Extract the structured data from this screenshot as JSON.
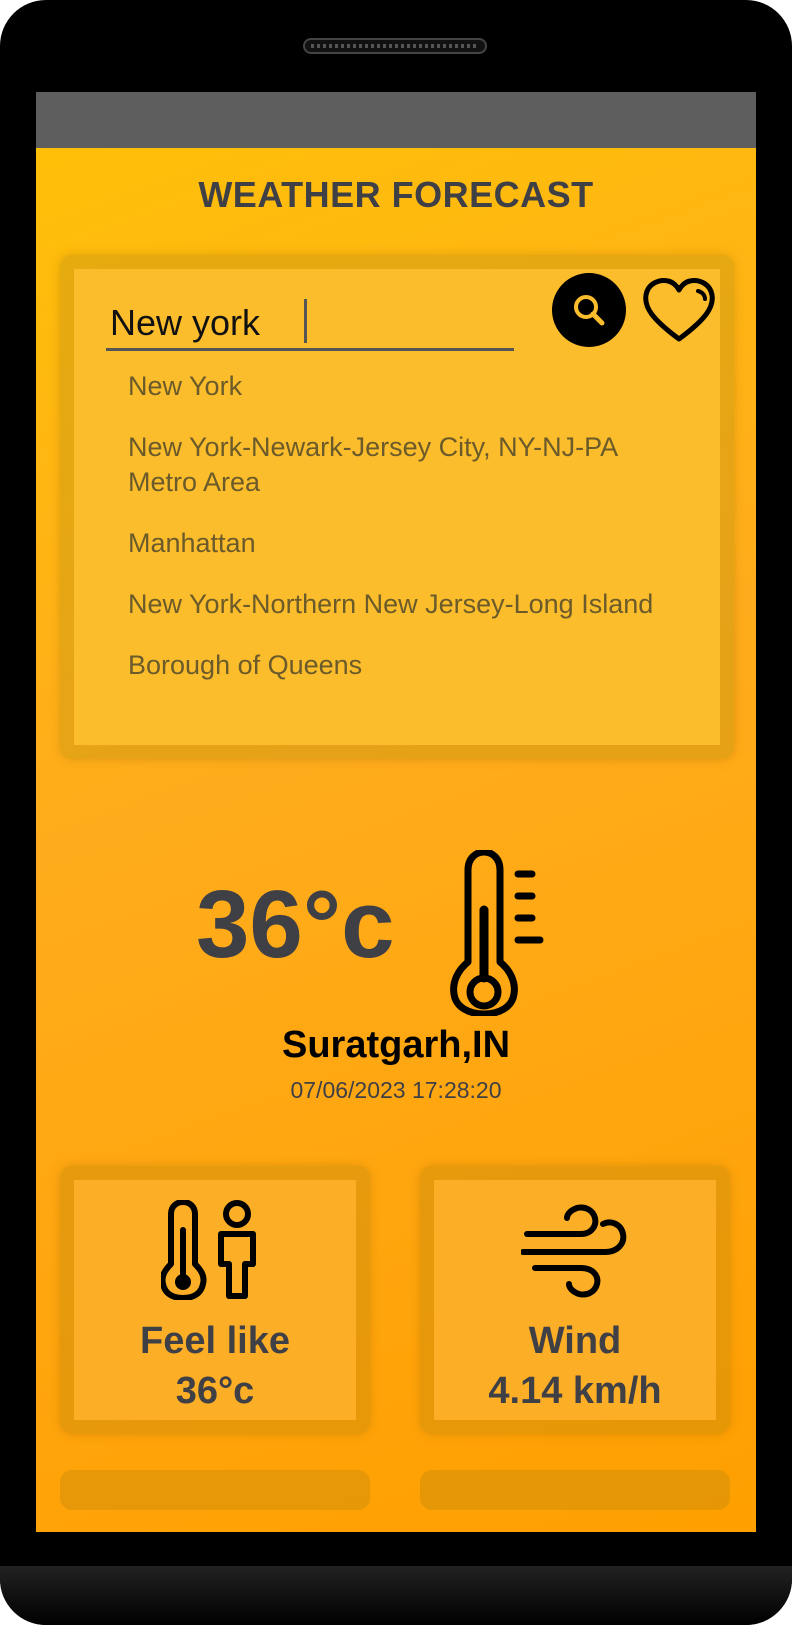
{
  "app": {
    "title": "WEATHER FORECAST"
  },
  "search": {
    "value": "New york",
    "suggestions": [
      "New York",
      "New York-Newark-Jersey City, NY-NJ-PA Metro Area",
      "Manhattan",
      "New York-Northern New Jersey-Long Island",
      "Borough of Queens"
    ]
  },
  "current": {
    "temperature": "36°c",
    "city": "Suratgarh,IN",
    "datetime": "07/06/2023 17:28:20"
  },
  "stats": {
    "feel": {
      "label": "Feel like",
      "value": "36°c",
      "icon": "thermometer-person-icon"
    },
    "wind": {
      "label": "Wind",
      "value": "4.14 km/h",
      "icon": "wind-icon"
    }
  },
  "colors": {
    "gradient_top": "#ffc107",
    "gradient_bottom": "#ff9f00",
    "text_dark": "#3f3f46",
    "status_bar": "#5e5e5e"
  }
}
